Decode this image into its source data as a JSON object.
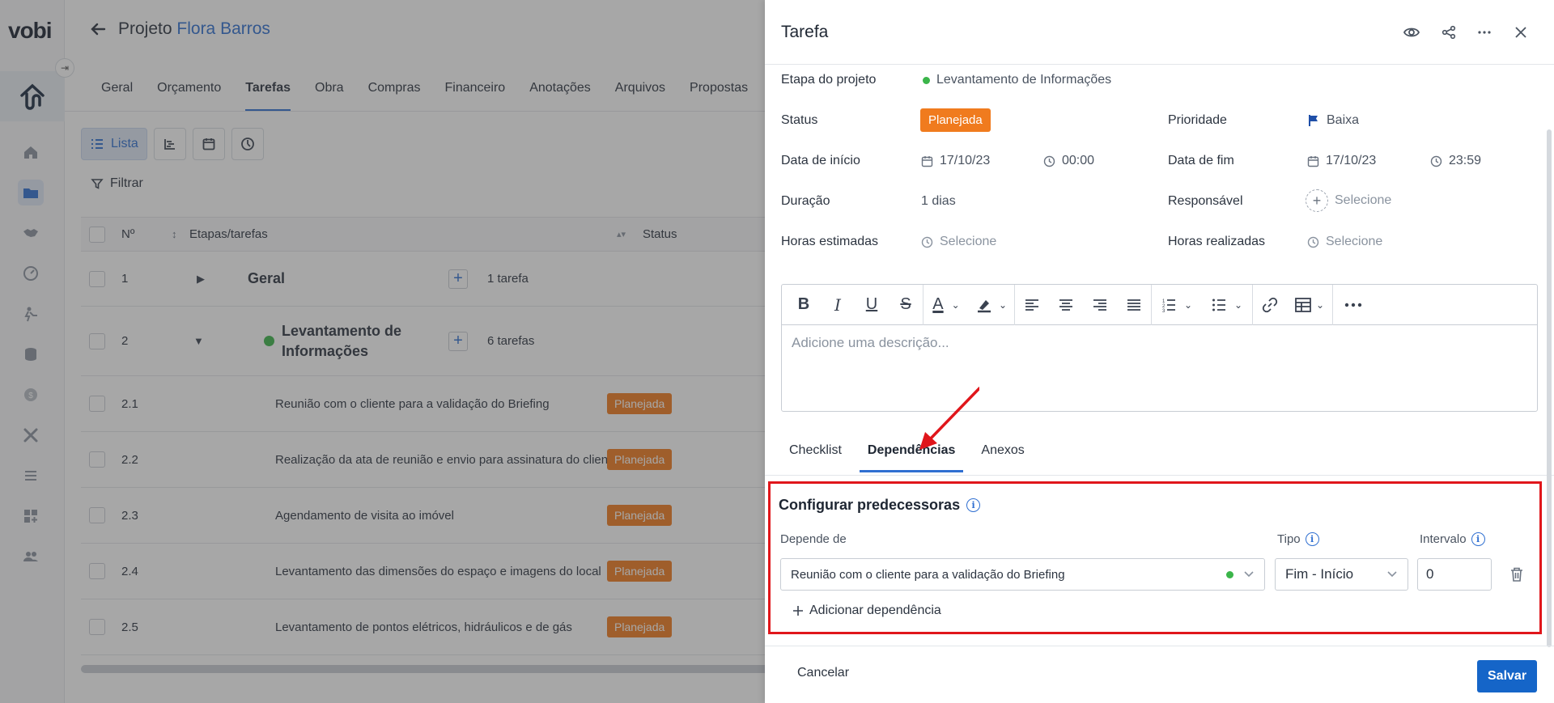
{
  "app": {
    "logo": "vobi"
  },
  "header": {
    "project_prefix": "Projeto",
    "client_name": "Flora Barros"
  },
  "tabs": [
    "Geral",
    "Orçamento",
    "Tarefas",
    "Obra",
    "Compras",
    "Financeiro",
    "Anotações",
    "Arquivos",
    "Propostas"
  ],
  "active_tab": "Tarefas",
  "viewbar": {
    "list_label": "Lista"
  },
  "filter_label": "Filtrar",
  "table": {
    "headers": {
      "num": "Nº",
      "stages": "Etapas/tarefas",
      "status": "Status"
    },
    "groups": [
      {
        "num": "1",
        "name": "Geral",
        "count": "1 tarefa"
      },
      {
        "num": "2",
        "name_line1": "Levantamento de",
        "name_line2": "Informações",
        "count": "6 tarefas"
      }
    ],
    "rows": [
      {
        "num": "2.1",
        "name": "Reunião com o cliente para a validação do Briefing",
        "status": "Planejada"
      },
      {
        "num": "2.2",
        "name": "Realização da ata de reunião e envio para assinatura do cliente",
        "status": "Planejada"
      },
      {
        "num": "2.3",
        "name": "Agendamento de visita ao imóvel",
        "status": "Planejada"
      },
      {
        "num": "2.4",
        "name": "Levantamento das dimensões do espaço e imagens do local",
        "status": "Planejada"
      },
      {
        "num": "2.5",
        "name": "Levantamento de pontos elétricos, hidráulicos e de gás",
        "status": "Planejada"
      }
    ]
  },
  "drawer": {
    "title": "Tarefa",
    "fields": {
      "stage_label": "Etapa do projeto",
      "stage_value": "Levantamento de Informações",
      "status_label": "Status",
      "status_value": "Planejada",
      "priority_label": "Prioridade",
      "priority_value": "Baixa",
      "start_label": "Data de início",
      "start_date": "17/10/23",
      "start_time": "00:00",
      "end_label": "Data de fim",
      "end_date": "17/10/23",
      "end_time": "23:59",
      "duration_label": "Duração",
      "duration_value": "1 dias",
      "responsible_label": "Responsável",
      "responsible_placeholder": "Selecione",
      "est_hours_label": "Horas estimadas",
      "est_hours_placeholder": "Selecione",
      "real_hours_label": "Horas realizadas",
      "real_hours_placeholder": "Selecione"
    },
    "editor_placeholder": "Adicione uma descrição...",
    "tabs": [
      "Checklist",
      "Dependências",
      "Anexos"
    ],
    "active_tab": "Dependências",
    "predecessors": {
      "title": "Configurar predecessoras",
      "depends_label": "Depende de",
      "type_label": "Tipo",
      "interval_label": "Intervalo",
      "depends_value": "Reunião com o cliente para a validação do Briefing",
      "type_value": "Fim - Início",
      "interval_value": "0",
      "add_label": "Adicionar dependência"
    },
    "cancel_label": "Cancelar",
    "save_label": "Salvar"
  },
  "colors": {
    "accent": "#2f6fd1",
    "status_orange": "#f07b1e",
    "highlight_red": "#e0161b",
    "save_blue": "#1565c8",
    "green_dot": "#3bb54a"
  }
}
